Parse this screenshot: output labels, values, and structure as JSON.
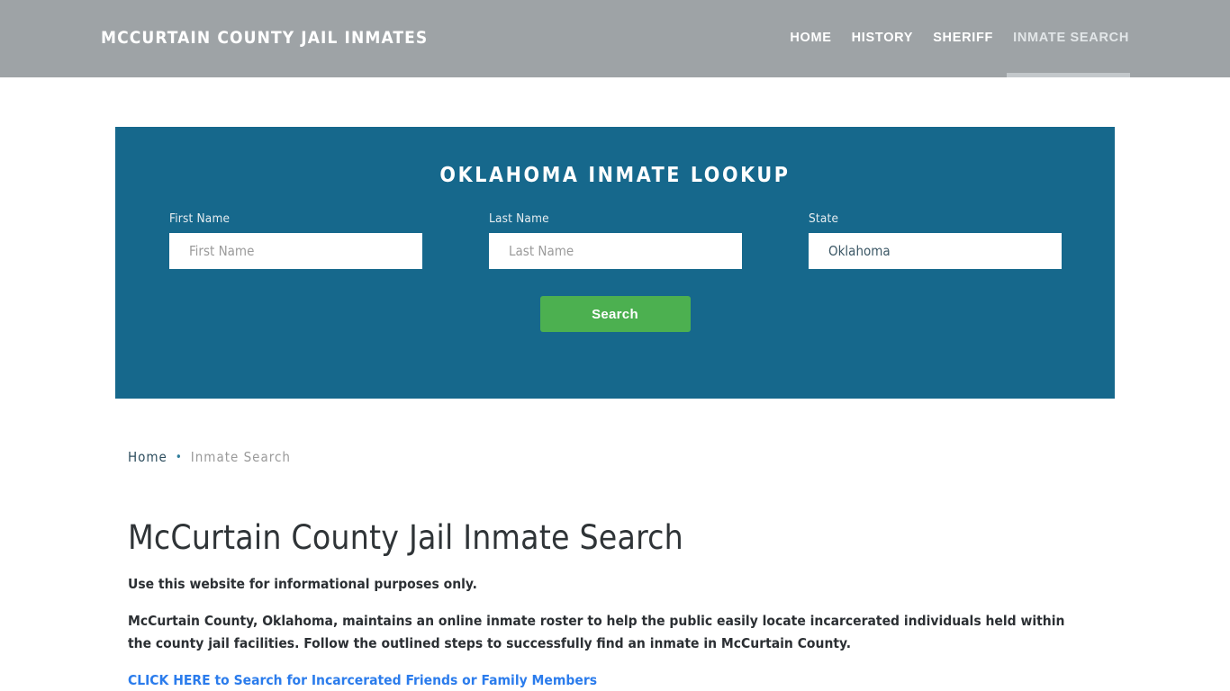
{
  "header": {
    "brand": "MCCURTAIN COUNTY JAIL INMATES",
    "background_color": "#9ea3a6",
    "nav": [
      {
        "label": "HOME",
        "active": false
      },
      {
        "label": "HISTORY",
        "active": false
      },
      {
        "label": "SHERIFF",
        "active": false
      },
      {
        "label": "INMATE SEARCH",
        "active": true
      }
    ]
  },
  "lookup": {
    "title": "OKLAHOMA INMATE LOOKUP",
    "panel_color": "#16688c",
    "fields": {
      "first": {
        "label": "First Name",
        "value": "",
        "placeholder": "First Name"
      },
      "last": {
        "label": "Last Name",
        "value": "",
        "placeholder": "Last Name"
      },
      "state": {
        "label": "State",
        "value": "Oklahoma",
        "options": [
          "Oklahoma"
        ]
      }
    },
    "submit_label": "Search",
    "submit_color": "#4cb050"
  },
  "breadcrumb": {
    "home": "Home",
    "separator": "•",
    "current": "Inmate Search"
  },
  "main": {
    "title": "McCurtain County Jail Inmate Search",
    "lede": "Use this website for informational purposes only.",
    "paragraph": "McCurtain County, Oklahoma, maintains an online inmate roster to help the public easily locate incarcerated individuals held within the county jail facilities. Follow the outlined steps to successfully find an inmate in McCurtain County.",
    "cta_label": "CLICK HERE to Search for Incarcerated Friends or Family Members",
    "cta_color": "#2b7cec"
  }
}
